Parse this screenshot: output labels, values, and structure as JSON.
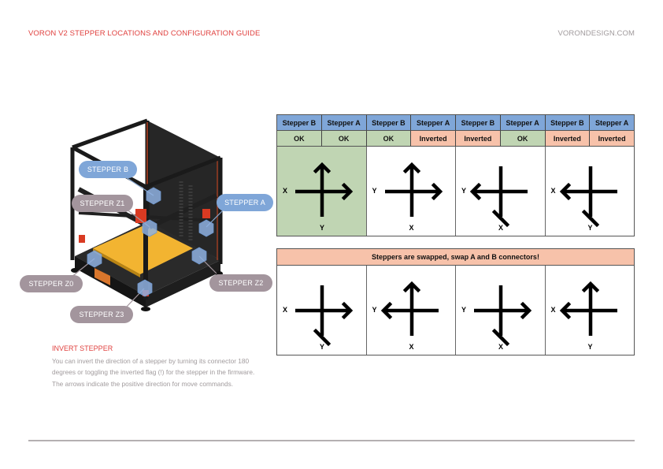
{
  "header": {
    "title": "VORON V2 STEPPER LOCATIONS AND CONFIGURATION GUIDE",
    "site": "VORONDESIGN.COM"
  },
  "colors": {
    "accent_red": "#e0413f",
    "stepper_blue": "#7fa6d8",
    "stepper_grey": "#a3959d",
    "ok_green": "#c0d5b3",
    "inverted_salmon": "#f7c2aa"
  },
  "callouts": [
    {
      "id": "b",
      "label": "STEPPER B",
      "color": "blue"
    },
    {
      "id": "z1",
      "label": "STEPPER Z1",
      "color": "grey"
    },
    {
      "id": "a",
      "label": "STEPPER A",
      "color": "blue"
    },
    {
      "id": "z0",
      "label": "STEPPER Z0",
      "color": "grey"
    },
    {
      "id": "z2",
      "label": "STEPPER Z2",
      "color": "grey"
    },
    {
      "id": "z3",
      "label": "STEPPER Z3",
      "color": "grey"
    }
  ],
  "info": {
    "title": "INVERT STEPPER",
    "body": "You can invert the direction of a stepper by turning its connector 180 degrees or toggling the inverted flag (!) for the stepper in the firmware. The arrows indicate the positive direction for move commands."
  },
  "table": {
    "headers": [
      "Stepper B",
      "Stepper A",
      "Stepper B",
      "Stepper A",
      "Stepper B",
      "Stepper A",
      "Stepper B",
      "Stepper A"
    ],
    "statuses": [
      {
        "value": "OK",
        "state": "ok"
      },
      {
        "value": "OK",
        "state": "ok"
      },
      {
        "value": "OK",
        "state": "ok"
      },
      {
        "value": "Inverted",
        "state": "inv"
      },
      {
        "value": "Inverted",
        "state": "inv"
      },
      {
        "value": "OK",
        "state": "ok"
      },
      {
        "value": "Inverted",
        "state": "inv"
      },
      {
        "value": "Inverted",
        "state": "inv"
      }
    ],
    "diagrams": [
      {
        "horizontal_label": "X",
        "horizontal_arrow": "right",
        "vertical_label": "Y",
        "vertical_arrow": "up",
        "highlight": true
      },
      {
        "horizontal_label": "Y",
        "horizontal_arrow": "right",
        "vertical_label": "X",
        "vertical_arrow": "up",
        "highlight": false
      },
      {
        "horizontal_label": "Y",
        "horizontal_arrow": "left",
        "vertical_label": "X",
        "vertical_arrow": "down",
        "highlight": false
      },
      {
        "horizontal_label": "X",
        "horizontal_arrow": "left",
        "vertical_label": "Y",
        "vertical_arrow": "down",
        "highlight": false
      }
    ]
  },
  "swapped": {
    "banner": "Steppers are swapped, swap A and B connectors!",
    "diagrams": [
      {
        "horizontal_label": "X",
        "horizontal_arrow": "right",
        "vertical_label": "Y",
        "vertical_arrow": "down"
      },
      {
        "horizontal_label": "Y",
        "horizontal_arrow": "left",
        "vertical_label": "X",
        "vertical_arrow": "up"
      },
      {
        "horizontal_label": "Y",
        "horizontal_arrow": "right",
        "vertical_label": "X",
        "vertical_arrow": "down"
      },
      {
        "horizontal_label": "X",
        "horizontal_arrow": "left",
        "vertical_label": "Y",
        "vertical_arrow": "up"
      }
    ]
  }
}
